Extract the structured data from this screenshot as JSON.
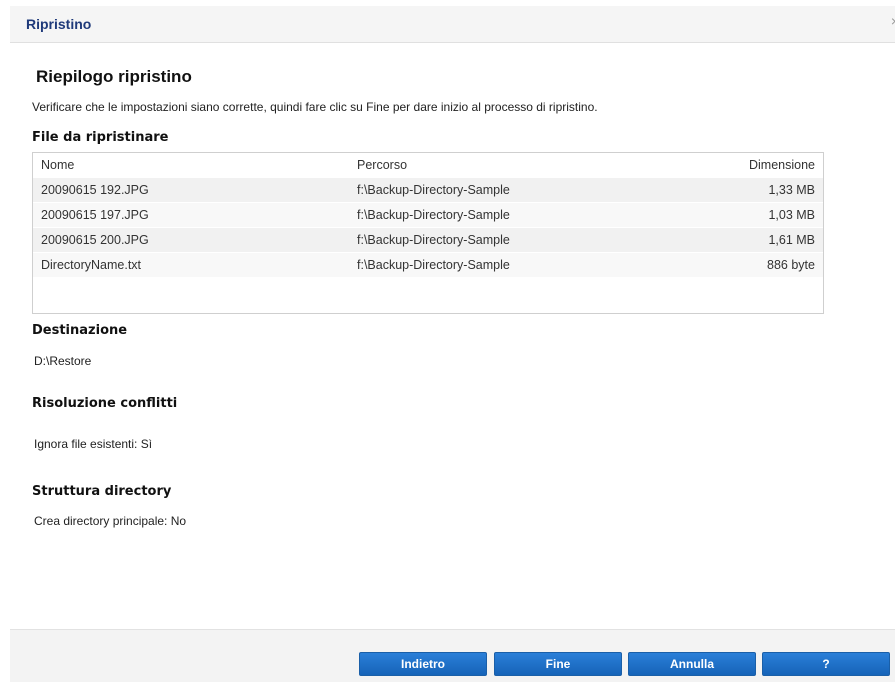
{
  "dialog": {
    "title": "Ripristino",
    "close_glyph": "×"
  },
  "summary": {
    "heading": "Riepilogo ripristino",
    "intro": "Verificare che le impostazioni siano corrette, quindi fare clic su Fine per dare inizio al processo di ripristino."
  },
  "files": {
    "section_title": "File da ripristinare",
    "columns": [
      "Nome",
      "Percorso",
      "Dimensione"
    ],
    "rows": [
      {
        "name": "20090615 192.JPG",
        "path": "f:\\Backup-Directory-Sample",
        "size": "1,33 MB"
      },
      {
        "name": "20090615 197.JPG",
        "path": "f:\\Backup-Directory-Sample",
        "size": "1,03 MB"
      },
      {
        "name": "20090615 200.JPG",
        "path": "f:\\Backup-Directory-Sample",
        "size": "1,61 MB"
      },
      {
        "name": "DirectoryName.txt",
        "path": "f:\\Backup-Directory-Sample",
        "size": "886 byte"
      }
    ]
  },
  "destination": {
    "section_title": "Destinazione",
    "value": "D:\\Restore"
  },
  "conflicts": {
    "section_title": "Risoluzione conflitti",
    "value": "Ignora file esistenti: Sì"
  },
  "directory": {
    "section_title": "Struttura directory",
    "value": "Crea directory principale: No"
  },
  "buttons": {
    "back": "Indietro",
    "finish": "Fine",
    "cancel": "Annulla",
    "help": "?"
  },
  "colors": {
    "title_text": "#1f3a7a",
    "button_blue": "#1d6fc8"
  }
}
